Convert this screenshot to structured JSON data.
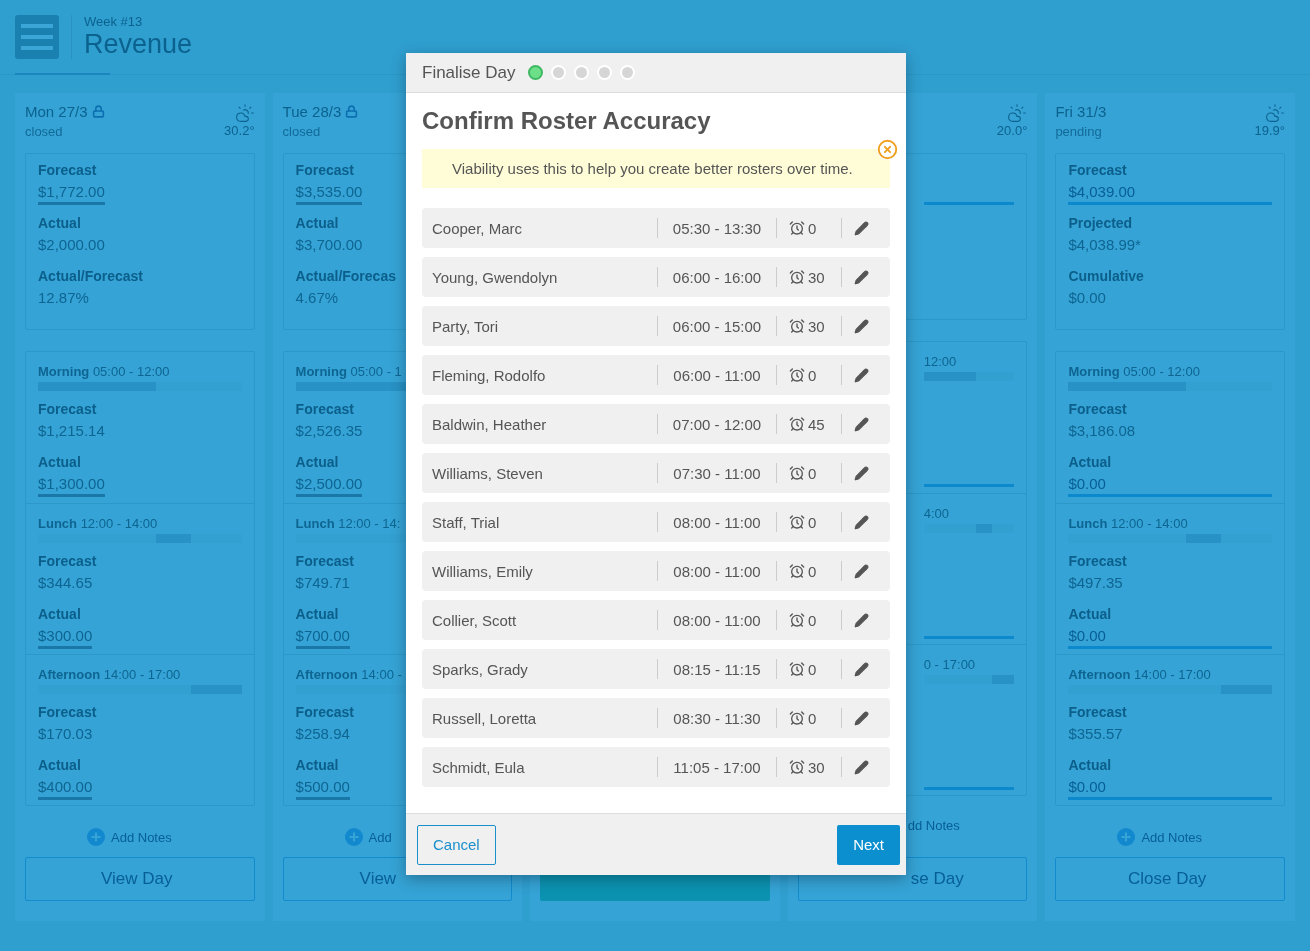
{
  "header": {
    "subtitle": "Week #13",
    "title": "Revenue"
  },
  "days": [
    {
      "kind": "full",
      "date": "Mon 27/3",
      "locked": true,
      "weather": true,
      "status": "closed",
      "temperature": "30.2°",
      "summary": [
        {
          "label": "Forecast",
          "value": "$1,772.00",
          "kind": "link"
        },
        {
          "label": "Actual",
          "value": "$2,000.00",
          "kind": "plain"
        },
        {
          "label": "Actual/Forecast",
          "value": "12.87%",
          "kind": "plain"
        }
      ],
      "periods": [
        {
          "name": "Morning",
          "time": "05:00 - 12:00",
          "fields": [
            {
              "label": "Forecast",
              "value": "$1,215.14",
              "kind": "plain"
            },
            {
              "label": "Actual",
              "value": "$1,300.00",
              "kind": "link"
            }
          ]
        },
        {
          "name": "Lunch",
          "time": "12:00 - 14:00",
          "fields": [
            {
              "label": "Forecast",
              "value": "$344.65",
              "kind": "plain"
            },
            {
              "label": "Actual",
              "value": "$300.00",
              "kind": "link"
            }
          ]
        },
        {
          "name": "Afternoon",
          "time": "14:00 - 17:00",
          "fields": [
            {
              "label": "Forecast",
              "value": "$170.03",
              "kind": "plain"
            },
            {
              "label": "Actual",
              "value": "$400.00",
              "kind": "link"
            }
          ]
        }
      ],
      "notes_icon": true,
      "notes": "Add Notes",
      "button": {
        "label": "View Day",
        "kind": "outline"
      }
    },
    {
      "kind": "clipped",
      "date": "Tue 28/3",
      "locked": true,
      "weather": false,
      "status": "closed",
      "summary": [
        {
          "label": "Forecast",
          "value": "$3,535.00",
          "kind": "link"
        },
        {
          "label": "Actual",
          "value": "$3,700.00",
          "kind": "plain"
        },
        {
          "label": "Actual/Forecas",
          "value": "4.67%",
          "kind": "plain"
        }
      ],
      "periods": [
        {
          "name": "Morning",
          "time": "05:00 - 1",
          "fields": [
            {
              "label": "Forecast",
              "value": "$2,526.35",
              "kind": "plain"
            },
            {
              "label": "Actual",
              "value": "$2,500.00",
              "kind": "link"
            }
          ]
        },
        {
          "name": "Lunch",
          "time": "12:00 - 14:",
          "fields": [
            {
              "label": "Forecast",
              "value": "$749.71",
              "kind": "plain"
            },
            {
              "label": "Actual",
              "value": "$700.00",
              "kind": "link"
            }
          ]
        },
        {
          "name": "Afternoon",
          "time": "14:00 -",
          "fields": [
            {
              "label": "Forecast",
              "value": "$258.94",
              "kind": "plain"
            },
            {
              "label": "Actual",
              "value": "$500.00",
              "kind": "link"
            }
          ]
        }
      ],
      "notes_icon": true,
      "notes": "Add",
      "button": {
        "label": "View",
        "kind": "outline"
      }
    },
    {
      "kind": "hidden",
      "button": {
        "kind": "filled"
      }
    },
    {
      "kind": "partial",
      "locked": false,
      "weather": true,
      "temperature": "20.0°",
      "summary": [
        {
          "kind": "input"
        }
      ],
      "periods": [
        {
          "time": "12:00",
          "fields": [
            {
              "kind": "blank"
            },
            {
              "kind": "input"
            }
          ]
        },
        {
          "time": "4:00",
          "fields": [
            {
              "kind": "blank"
            },
            {
              "kind": "input"
            }
          ]
        },
        {
          "time": "0 - 17:00",
          "fields": [
            {
              "kind": "blank"
            },
            {
              "kind": "input"
            }
          ]
        }
      ],
      "notes_icon": false,
      "notes": "dd Notes",
      "button": {
        "label": "se Day",
        "kind": "outline"
      }
    },
    {
      "kind": "full",
      "date": "Fri 31/3",
      "locked": false,
      "weather": true,
      "status": "pending",
      "temperature": "19.9°",
      "summary": [
        {
          "label": "Forecast",
          "value": "$4,039.00",
          "kind": "input"
        },
        {
          "label": "Projected",
          "value": "$4,038.99*",
          "kind": "plain"
        },
        {
          "label": "Cumulative",
          "value": "$0.00",
          "kind": "plain"
        }
      ],
      "periods": [
        {
          "name": "Morning",
          "time": "05:00 - 12:00",
          "fields": [
            {
              "label": "Forecast",
              "value": "$3,186.08",
              "kind": "plain"
            },
            {
              "label": "Actual",
              "value": "$0.00",
              "kind": "input"
            }
          ]
        },
        {
          "name": "Lunch",
          "time": "12:00 - 14:00",
          "fields": [
            {
              "label": "Forecast",
              "value": "$497.35",
              "kind": "plain"
            },
            {
              "label": "Actual",
              "value": "$0.00",
              "kind": "input"
            }
          ]
        },
        {
          "name": "Afternoon",
          "time": "14:00 - 17:00",
          "fields": [
            {
              "label": "Forecast",
              "value": "$355.57",
              "kind": "plain"
            },
            {
              "label": "Actual",
              "value": "$0.00",
              "kind": "input"
            }
          ]
        }
      ],
      "notes_icon": true,
      "notes": "Add Notes",
      "button": {
        "label": "Close Day",
        "kind": "outline"
      }
    }
  ],
  "modal": {
    "title": "Finalise Day",
    "steps": [
      {
        "selected": true
      },
      {
        "selected": false
      },
      {
        "selected": false
      },
      {
        "selected": false
      },
      {
        "selected": false
      }
    ],
    "heading": "Confirm Roster Accuracy",
    "notice": "Viability uses this to help you create better rosters over time.",
    "roster": [
      {
        "name": "Cooper, Marc",
        "shift": "05:30 - 13:30",
        "break": "0"
      },
      {
        "name": "Young, Gwendolyn",
        "shift": "06:00 - 16:00",
        "break": "30"
      },
      {
        "name": "Party, Tori",
        "shift": "06:00 - 15:00",
        "break": "30"
      },
      {
        "name": "Fleming, Rodolfo",
        "shift": "06:00 - 11:00",
        "break": "0"
      },
      {
        "name": "Baldwin, Heather",
        "shift": "07:00 - 12:00",
        "break": "45"
      },
      {
        "name": "Williams, Steven",
        "shift": "07:30 - 11:00",
        "break": "0"
      },
      {
        "name": "Staff, Trial",
        "shift": "08:00 - 11:00",
        "break": "0"
      },
      {
        "name": "Williams, Emily",
        "shift": "08:00 - 11:00",
        "break": "0"
      },
      {
        "name": "Collier, Scott",
        "shift": "08:00 - 11:00",
        "break": "0"
      },
      {
        "name": "Sparks, Grady",
        "shift": "08:15 - 11:15",
        "break": "0"
      },
      {
        "name": "Russell, Loretta",
        "shift": "08:30 - 11:30",
        "break": "0"
      },
      {
        "name": "Schmidt, Eula",
        "shift": "11:05 - 17:00",
        "break": "30"
      }
    ],
    "cancel": "Cancel",
    "next": "Next"
  }
}
